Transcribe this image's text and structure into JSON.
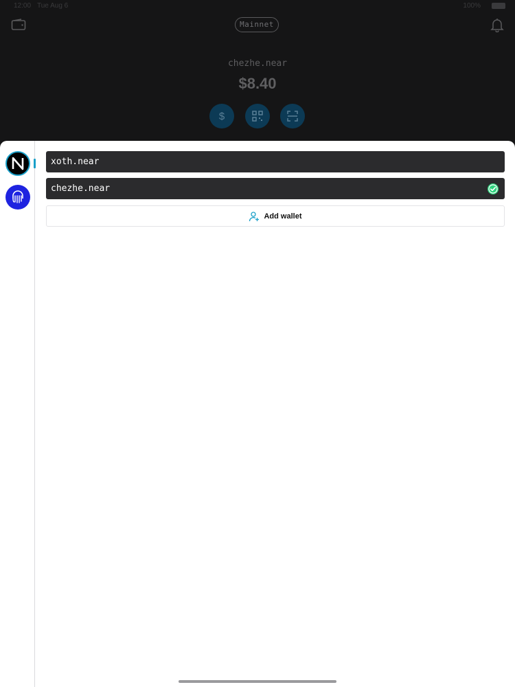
{
  "status_bar": {
    "time": "12:00",
    "date": "Tue Aug 6",
    "battery": "100%"
  },
  "header": {
    "network_label": "Mainnet",
    "account_name": "chezhe.near",
    "balance": "$8.40"
  },
  "actions": [
    {
      "icon": "dollar-icon"
    },
    {
      "icon": "qr-code-icon"
    },
    {
      "icon": "scan-icon"
    }
  ],
  "sheet": {
    "networks": [
      {
        "name": "NEAR",
        "icon": "near-logo-icon",
        "selected": true
      },
      {
        "name": "Octopus",
        "icon": "octopus-logo-icon",
        "selected": false
      }
    ],
    "wallets": [
      {
        "name": "xoth.near",
        "selected": false
      },
      {
        "name": "chezhe.near",
        "selected": true
      }
    ],
    "add_wallet_label": "Add wallet"
  },
  "colors": {
    "accent": "#1aa0c9",
    "check": "#2fd27d",
    "row_bg": "#2b2b2d",
    "octopus": "#1e23e0"
  }
}
